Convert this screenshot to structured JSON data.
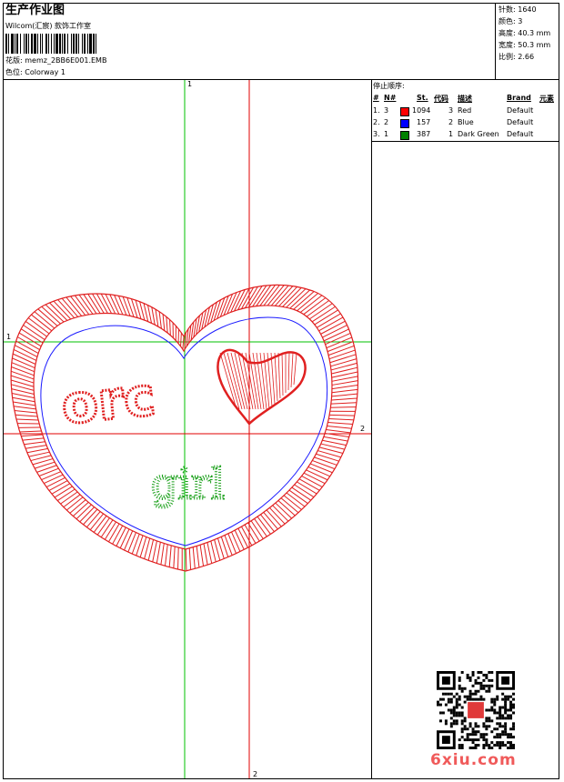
{
  "header": {
    "title": "生产作业图",
    "company": "Wilcom(汇宸) 款饰工作室",
    "design_label": "花版:",
    "design_file": "memz_2BB6E001.EMB",
    "colorway_label": "色位:",
    "colorway": "Colorway 1"
  },
  "stats": [
    {
      "label": "针数:",
      "value": "1640"
    },
    {
      "label": "颜色:",
      "value": "3"
    },
    {
      "label": "高度:",
      "value": "40.3 mm"
    },
    {
      "label": "宽度:",
      "value": "50.3 mm"
    },
    {
      "label": "比例:",
      "value": "2.66"
    }
  ],
  "stop_sequence": {
    "title": "停止顺序:",
    "headers": [
      "#",
      "N#",
      "St.",
      "代码",
      "描述",
      "Brand",
      "元素"
    ],
    "rows": [
      {
        "index": "1.",
        "n": "3",
        "color": "#ff0000",
        "stitches": "1094",
        "code": "3",
        "desc": "Red",
        "brand": "Default"
      },
      {
        "index": "2.",
        "n": "2",
        "color": "#0000ff",
        "stitches": "157",
        "code": "2",
        "desc": "Blue",
        "brand": "Default"
      },
      {
        "index": "3.",
        "n": "1",
        "color": "#008000",
        "stitches": "387",
        "code": "1",
        "desc": "Dark Green",
        "brand": "Default"
      }
    ]
  },
  "axes": {
    "v1": "1",
    "h1": "1",
    "h2": "2",
    "v2": "2"
  },
  "design": {
    "line1": "orc",
    "line2": "girl"
  },
  "watermark": "6xiu.com",
  "colors": {
    "red": "#e02020",
    "blue": "#1a1aff",
    "green": "#1aa01a",
    "guide_green": "#00c000",
    "guide_red": "#e00000"
  }
}
